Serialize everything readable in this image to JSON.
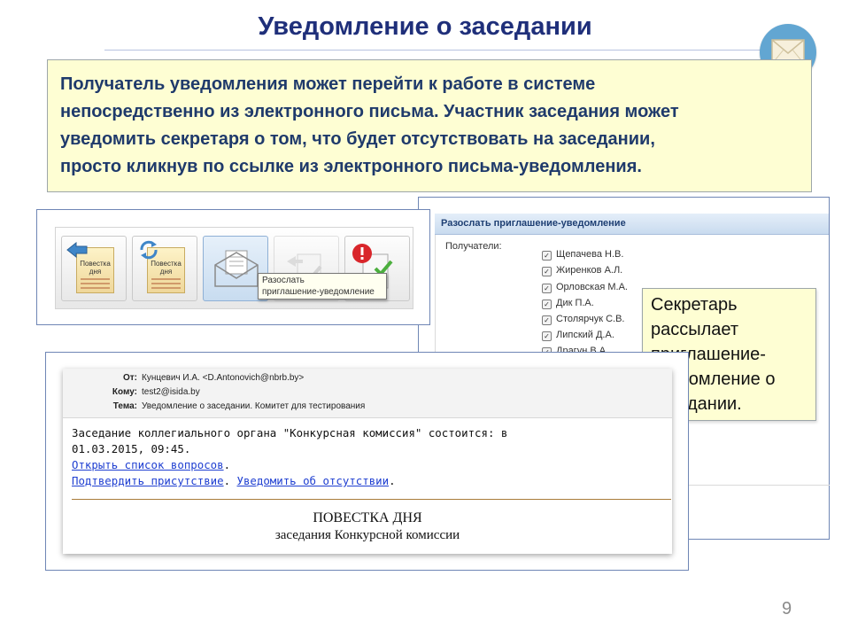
{
  "slide": {
    "title": "Уведомление о заседании",
    "intro_lines": [
      "Получатель уведомления может перейти к работе в системе",
      "непосредственно из электронного письма. Участник заседания может",
      "уведомить секретаря о том, что будет отсутствовать на заседании,",
      "просто кликнув по ссылке из электронного письма-уведомления."
    ],
    "page_number": "9",
    "badge_icon": "envelope-icon"
  },
  "toolbar": {
    "doc_label_line1": "Повестка",
    "doc_label_line2": "дня",
    "tooltip_line1": "Разослать",
    "tooltip_line2": "приглашение-уведомление"
  },
  "invite_dialog": {
    "title": "Разослать приглашение-уведомление",
    "recipients_label": "Получатели:",
    "recipients": [
      "Щепачева Н.В.",
      "Жиренков А.Л.",
      "Орловская М.А.",
      "Дик П.А.",
      "Столярчук С.В.",
      "Липский Д.А.",
      "Драгун В.А."
    ]
  },
  "callout": {
    "lines": [
      "Секретарь",
      "рассылает",
      "приглашение-",
      "уведомление о",
      "заседании."
    ]
  },
  "email": {
    "from_label": "От:",
    "from_value": "Кунцевич И.А. <D.Antonovich@nbrb.by>",
    "to_label": "Кому:",
    "to_value": "test2@isida.by",
    "subject_label": "Тема:",
    "subject_value": "Уведомление о заседании. Комитет для тестирования",
    "body_line1": "Заседание коллегиального органа \"Конкурсная комиссия\" состоится: в",
    "body_line2": "01.03.2015, 09:45.",
    "link_open": "Открыть список вопросов",
    "link_confirm": "Подтвердить присутствие",
    "link_absent": "Уведомить об отсутствии",
    "agenda_title": "ПОВЕСТКА ДНЯ",
    "agenda_subtitle": "заседания Конкурсной комиссии"
  },
  "colors": {
    "title": "#1f2f7a",
    "callout_bg": "#fefed3",
    "badge": "#62a6d2",
    "link": "#1f3fd1"
  }
}
